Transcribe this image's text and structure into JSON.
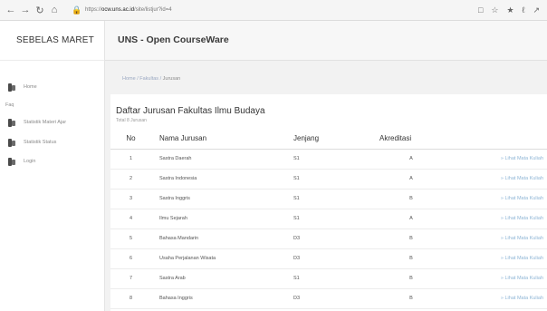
{
  "browser": {
    "url_host": "ocw.uns.ac.id",
    "url_prefix": "https://",
    "url_path": "/site/listjur?id=4"
  },
  "sidebar": {
    "brand": "SEBELAS MARET",
    "items": [
      {
        "label": "Home",
        "icon": "folder-icon"
      },
      {
        "label": "Faq",
        "icon": ""
      },
      {
        "label": "Statistik Materi Ajar",
        "icon": "folder-icon"
      },
      {
        "label": "Statistik Status",
        "icon": "folder-icon"
      },
      {
        "label": "Login",
        "icon": "folder-icon"
      }
    ]
  },
  "header": {
    "title": "UNS - Open CourseWare"
  },
  "breadcrumb": {
    "home": "Home",
    "sep": "/",
    "fakultas": "Fakultas",
    "current": "Jurusan"
  },
  "card": {
    "title": "Daftar Jurusan Fakultas Ilmu Budaya",
    "subtitle": "Total 8 Jurusan"
  },
  "table": {
    "headers": {
      "no": "No",
      "nama": "Nama Jurusan",
      "jenjang": "Jenjang",
      "akreditasi": "Akreditasi"
    },
    "link_label": "Lihat Mata Kuliah",
    "rows": [
      {
        "no": "1",
        "nama": "Sastra Daerah",
        "jenjang": "S1",
        "akreditasi": "A"
      },
      {
        "no": "2",
        "nama": "Sastra Indonesia",
        "jenjang": "S1",
        "akreditasi": "A"
      },
      {
        "no": "3",
        "nama": "Sastra Inggris",
        "jenjang": "S1",
        "akreditasi": "B"
      },
      {
        "no": "4",
        "nama": "Ilmu Sejarah",
        "jenjang": "S1",
        "akreditasi": "A"
      },
      {
        "no": "5",
        "nama": "Bahasa Mandarin",
        "jenjang": "D3",
        "akreditasi": "B"
      },
      {
        "no": "6",
        "nama": "Usaha Perjalanan Wisata",
        "jenjang": "D3",
        "akreditasi": "B"
      },
      {
        "no": "7",
        "nama": "Sastra Arab",
        "jenjang": "S1",
        "akreditasi": "B"
      },
      {
        "no": "8",
        "nama": "Bahasa Inggris",
        "jenjang": "D3",
        "akreditasi": "B"
      }
    ]
  }
}
